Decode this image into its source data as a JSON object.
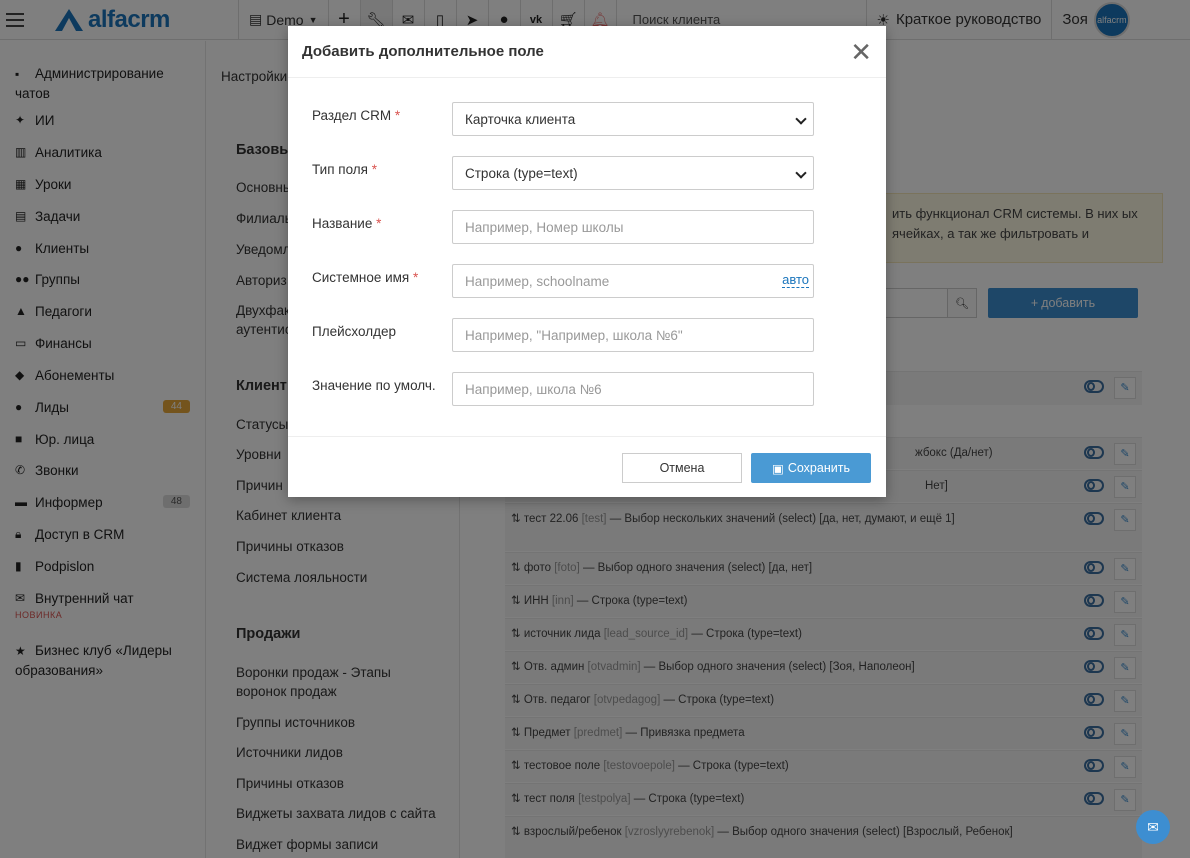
{
  "topbar": {
    "logo": "alfacrm",
    "demo_label": "Demo",
    "search_placeholder": "Поиск клиента",
    "guide_label": "Краткое руководство",
    "user_name": "Зоя",
    "avatar_text": "alfacrm"
  },
  "sidebar": {
    "items": [
      {
        "label": "Администрирование чатов"
      },
      {
        "label": "ИИ"
      },
      {
        "label": "Аналитика"
      },
      {
        "label": "Уроки"
      },
      {
        "label": "Задачи"
      },
      {
        "label": "Клиенты"
      },
      {
        "label": "Группы"
      },
      {
        "label": "Педагоги"
      },
      {
        "label": "Финансы"
      },
      {
        "label": "Абонементы"
      },
      {
        "label": "Лиды",
        "badge": "44"
      },
      {
        "label": "Юр. лица"
      },
      {
        "label": "Звонки"
      },
      {
        "label": "Информер",
        "badge": "48"
      },
      {
        "label": "Доступ в CRM"
      },
      {
        "label": "Podpislon"
      },
      {
        "label": "Внутренний чат",
        "tag": "НОВИНКА"
      },
      {
        "label": "Бизнес клуб «Лидеры образования»"
      }
    ]
  },
  "settings_nav": {
    "breadcrumb": "Настройки",
    "section_base": "Базовы",
    "base_links": [
      "Основны",
      "Филиалы",
      "Уведомл",
      "Авториз",
      "Двухфак аутентис"
    ],
    "section_clients": "Клиент",
    "client_links": [
      "Статусы",
      "Уровни",
      "Причин",
      "Кабинет клиента",
      "Причины отказов",
      "Система лояльности"
    ],
    "section_sales": "Продажи",
    "sales_links": [
      "Воронки продаж - Этапы воронок продаж",
      "Группы источников",
      "Источники лидов",
      "Причины отказов",
      "Виджеты захвата лидов с сайта",
      "Виджет формы записи"
    ]
  },
  "main": {
    "notice": "ить функционал CRM системы. В них ых ячейках, а так же фильтровать и",
    "add_button": "добавить",
    "rows": [
      {
        "pre": "",
        "sys": "",
        "post": ""
      },
      {
        "pre": "",
        "sys": "",
        "post": "жбокс (Да/нет)"
      },
      {
        "pre": "",
        "sys": "",
        "post": "Нет]"
      },
      {
        "pre": "тест 22.06 ",
        "sys": "[test]",
        "post": " — Выбор нескольких значений (select)     [да, нет, думают, и ещё 1]"
      },
      {
        "pre": "фото ",
        "sys": "[foto]",
        "post": " — Выбор одного значения (select)     [да, нет]"
      },
      {
        "pre": "ИНН ",
        "sys": "[inn]",
        "post": " — Строка (type=text)"
      },
      {
        "pre": "источник лида ",
        "sys": "[lead_source_id]",
        "post": " — Строка (type=text)"
      },
      {
        "pre": "Отв. админ ",
        "sys": "[otvadmin]",
        "post": " — Выбор одного значения (select)     [Зоя, Наполеон]"
      },
      {
        "pre": "Отв. педагог ",
        "sys": "[otvpedagog]",
        "post": " — Строка (type=text)"
      },
      {
        "pre": "Предмет ",
        "sys": "[predmet]",
        "post": " — Привязка предмета"
      },
      {
        "pre": "тестовое поле ",
        "sys": "[testovoepole]",
        "post": " — Строка (type=text)"
      },
      {
        "pre": "тест поля ",
        "sys": "[testpolya]",
        "post": " — Строка (type=text)"
      },
      {
        "pre": "взрослый/ребенок ",
        "sys": "[vzroslyyrebenok]",
        "post": " — Выбор одного значения (select) [Взрослый, Ребенок]"
      }
    ]
  },
  "modal": {
    "title": "Добавить дополнительное поле",
    "fields": [
      {
        "label": "Раздел CRM",
        "required": "*",
        "value": "Карточка клиента"
      },
      {
        "label": "Тип поля",
        "required": "*",
        "value": "Строка (type=text)"
      },
      {
        "label": "Название",
        "required": "*",
        "placeholder": "Например, Номер школы"
      },
      {
        "label": "Системное имя",
        "required": "*",
        "placeholder": "Например, schoolname",
        "aux": "авто"
      },
      {
        "label": "Плейсхолдер",
        "required": "",
        "placeholder": "Например, \"Например, школа №6\""
      },
      {
        "label": "Значение по умолч.",
        "required": "",
        "placeholder": "Например, школа №6"
      }
    ],
    "cancel_label": "Отмена",
    "save_label": "Сохранить"
  }
}
